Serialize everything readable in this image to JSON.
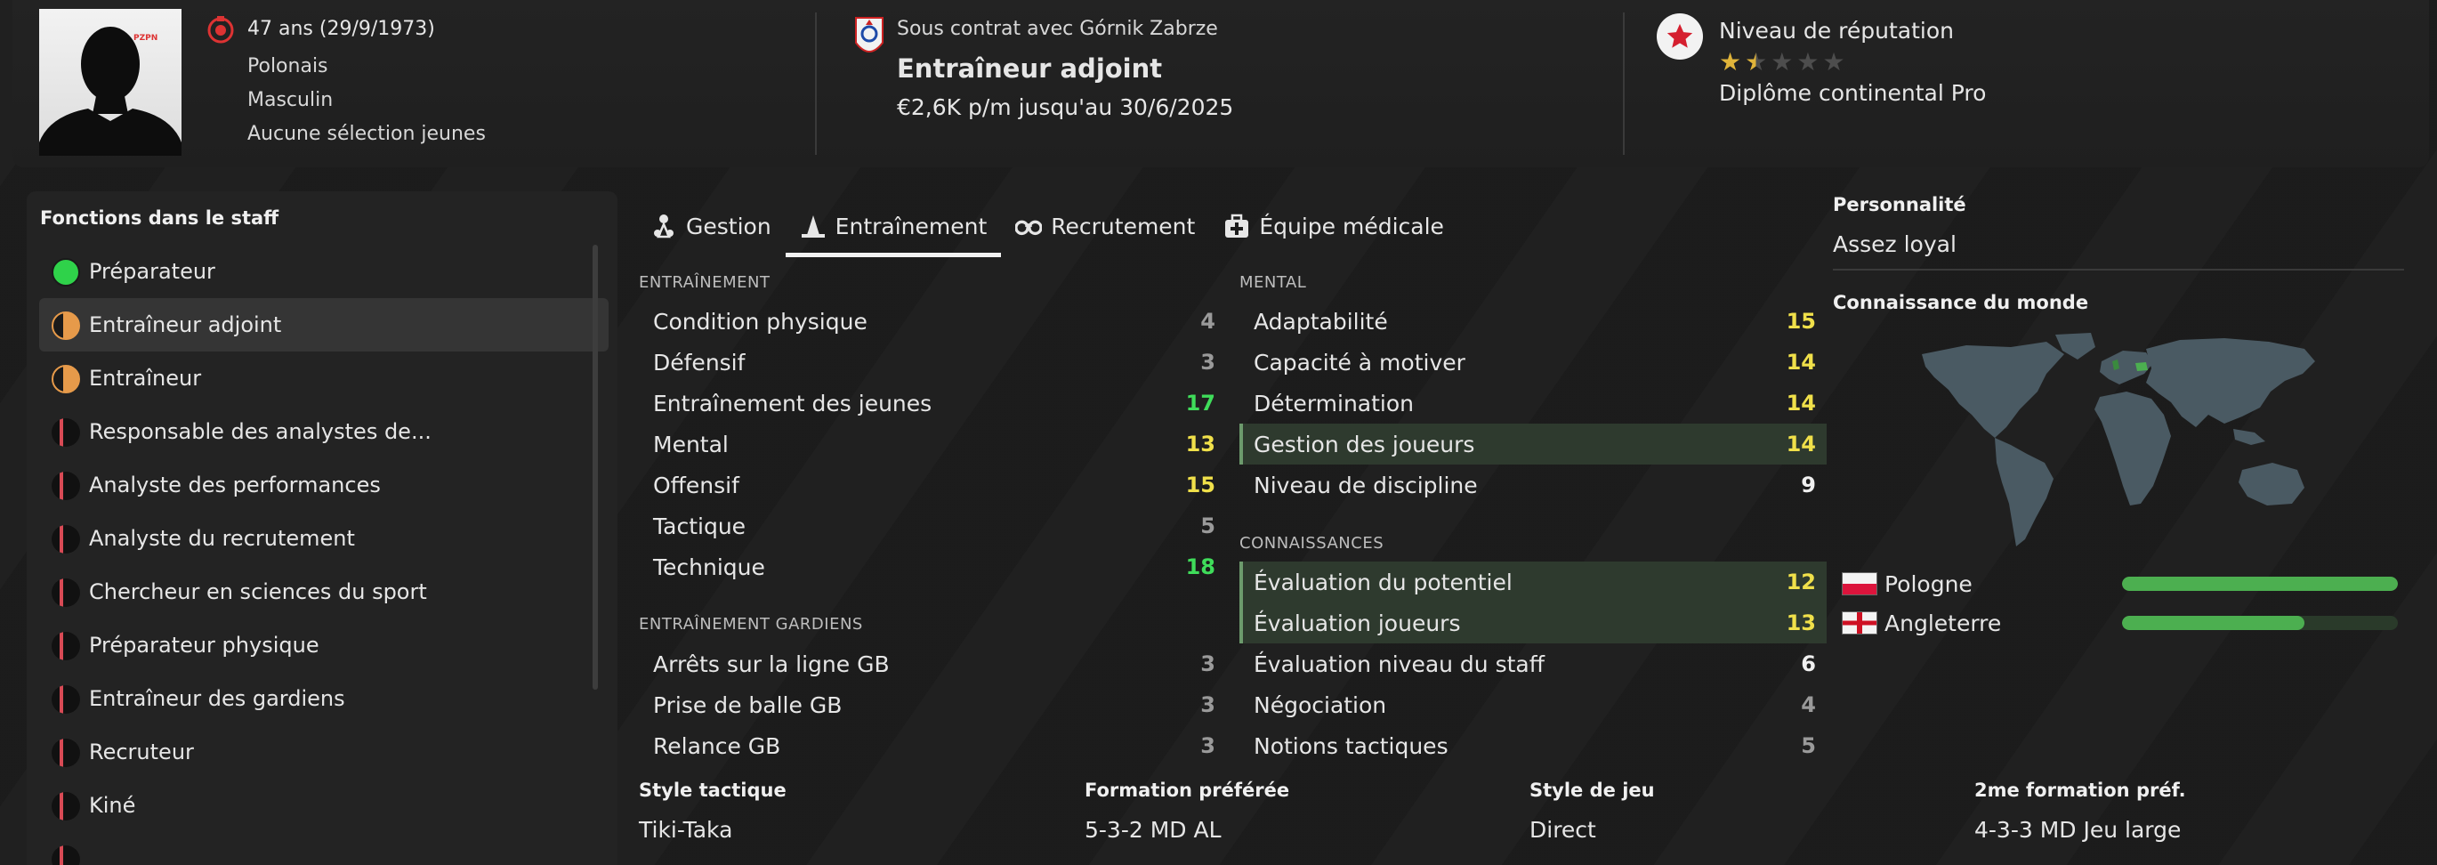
{
  "header": {
    "age": "47 ans (29/9/1973)",
    "nationality": "Polonais",
    "gender": "Masculin",
    "caps": "Aucune sélection jeunes",
    "contract": "Sous contrat avec Górnik Zabrze",
    "role": "Entraîneur adjoint",
    "wage": "€2,6K p/m jusqu'au 30/6/2025",
    "reputation_label": "Niveau de réputation",
    "reputation_stars": 1.5,
    "reputation_max": 5,
    "license": "Diplôme continental Pro",
    "flag_text": "PZPN"
  },
  "staff_roles": {
    "title": "Fonctions dans le staff",
    "items": [
      {
        "label": "Préparateur",
        "dot": "green"
      },
      {
        "label": "Entraîneur adjoint",
        "dot": "half-orange",
        "selected": true
      },
      {
        "label": "Entraîneur",
        "dot": "half-orange"
      },
      {
        "label": "Responsable des analystes de...",
        "dot": "red-sliver"
      },
      {
        "label": "Analyste des performances",
        "dot": "red-sliver"
      },
      {
        "label": "Analyste du recrutement",
        "dot": "red-sliver"
      },
      {
        "label": "Chercheur en sciences du sport",
        "dot": "red-sliver"
      },
      {
        "label": "Préparateur physique",
        "dot": "red-sliver"
      },
      {
        "label": "Entraîneur des gardiens",
        "dot": "red-sliver"
      },
      {
        "label": "Recruteur",
        "dot": "red-sliver"
      },
      {
        "label": "Kiné",
        "dot": "red-sliver"
      }
    ]
  },
  "tabs": [
    {
      "label": "Gestion",
      "icon": "manager-icon"
    },
    {
      "label": "Entraînement",
      "icon": "cone-icon",
      "active": true
    },
    {
      "label": "Recrutement",
      "icon": "binoculars-icon"
    },
    {
      "label": "Équipe médicale",
      "icon": "medical-kit-icon"
    }
  ],
  "attributes": {
    "training_title": "ENTRAÎNEMENT",
    "training": [
      {
        "name": "Condition physique",
        "value": 4
      },
      {
        "name": "Défensif",
        "value": 3
      },
      {
        "name": "Entraînement des jeunes",
        "value": 17
      },
      {
        "name": "Mental",
        "value": 13
      },
      {
        "name": "Offensif",
        "value": 15
      },
      {
        "name": "Tactique",
        "value": 5
      },
      {
        "name": "Technique",
        "value": 18
      }
    ],
    "gk_title": "ENTRAÎNEMENT GARDIENS",
    "gk": [
      {
        "name": "Arrêts sur la ligne GB",
        "value": 3
      },
      {
        "name": "Prise de balle GB",
        "value": 3
      },
      {
        "name": "Relance GB",
        "value": 3
      }
    ],
    "mental_title": "MENTAL",
    "mental": [
      {
        "name": "Adaptabilité",
        "value": 15
      },
      {
        "name": "Capacité à motiver",
        "value": 14
      },
      {
        "name": "Détermination",
        "value": 14
      },
      {
        "name": "Gestion des joueurs",
        "value": 14,
        "highlight": true
      },
      {
        "name": "Niveau de discipline",
        "value": 9
      }
    ],
    "knowledge_title": "CONNAISSANCES",
    "knowledge": [
      {
        "name": "Évaluation du potentiel",
        "value": 12,
        "highlight": true
      },
      {
        "name": "Évaluation joueurs",
        "value": 13,
        "highlight": true
      },
      {
        "name": "Évaluation niveau du staff",
        "value": 6
      },
      {
        "name": "Négociation",
        "value": 4
      },
      {
        "name": "Notions tactiques",
        "value": 5
      }
    ]
  },
  "bottom": {
    "style_label": "Style tactique",
    "style_value": "Tiki-Taka",
    "formation_label": "Formation préférée",
    "formation_value": "5-3-2 MD AL",
    "play_label": "Style de jeu",
    "play_value": "Direct",
    "formation2_label": "2me formation préf.",
    "formation2_value": "4-3-3 MD Jeu large"
  },
  "right": {
    "personality_label": "Personnalité",
    "personality_value": "Assez loyal",
    "world_label": "Connaissance du monde",
    "countries": [
      {
        "name": "Pologne",
        "level": 1.0
      },
      {
        "name": "Angleterre",
        "level": 0.66
      }
    ]
  },
  "colors": {
    "value_green": "#3fdc5a",
    "value_yellow": "#f0e04a",
    "bar_green": "#4caf50",
    "highlight_row": "#2e3a2e",
    "dot_green": "#2fd24a",
    "dot_orange": "#e69a4a",
    "dot_red": "#d84a55"
  }
}
